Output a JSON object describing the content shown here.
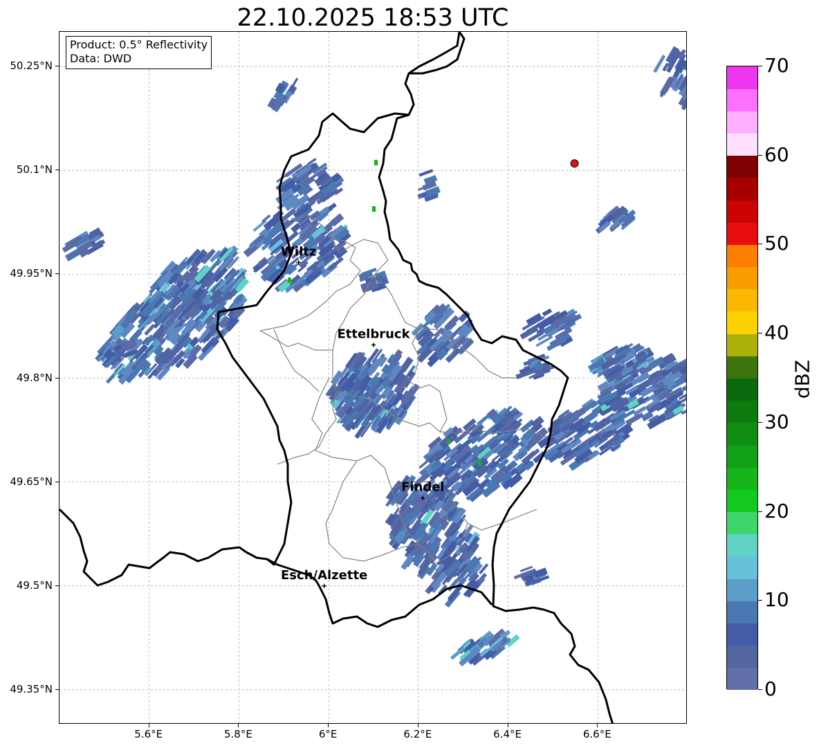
{
  "title": "22.10.2025 18:53 UTC",
  "info": {
    "product": "Product: 0.5° Reflectivity",
    "data": "Data: DWD"
  },
  "map": {
    "lat_labels": [
      "50.25°N",
      "50.1°N",
      "49.95°N",
      "49.8°N",
      "49.65°N",
      "49.5°N",
      "49.35°N"
    ],
    "lon_labels": [
      "5.6°E",
      "5.8°E",
      "6°E",
      "6.2°E",
      "6.4°E",
      "6.6°E"
    ],
    "lat_range": [
      49.3,
      50.3
    ],
    "lon_range": [
      5.4,
      6.8
    ],
    "cities": [
      {
        "name": "Wiltz",
        "lat": 49.967,
        "lon": 5.933
      },
      {
        "name": "Ettelbruck",
        "lat": 49.848,
        "lon": 6.1
      },
      {
        "name": "Findel",
        "lat": 49.627,
        "lon": 6.21
      },
      {
        "name": "Esch/Alzette",
        "lat": 49.5,
        "lon": 5.99
      }
    ],
    "radar_site": {
      "lat": 50.11,
      "lon": 6.548,
      "color": "#e5111a"
    }
  },
  "colorbar": {
    "unit": "dBZ",
    "ticks": [
      "0",
      "10",
      "20",
      "30",
      "40",
      "50",
      "60",
      "70"
    ],
    "min": 0,
    "max": 70,
    "colors": [
      "#6170a8",
      "#54669f",
      "#435ca5",
      "#4a78b3",
      "#5c9ec9",
      "#67c1db",
      "#5fd4c4",
      "#3ed66c",
      "#13c920",
      "#14b61a",
      "#12a116",
      "#108e14",
      "#0d7a10",
      "#0a6a0d",
      "#3d7410",
      "#aeb00a",
      "#fbd200",
      "#fab800",
      "#f99e00",
      "#fd7f00",
      "#e80e0d",
      "#cb0303",
      "#a80000",
      "#7e0000",
      "#ffe0ff",
      "#ffb0ff",
      "#ff70ff",
      "#ee36ee"
    ]
  }
}
